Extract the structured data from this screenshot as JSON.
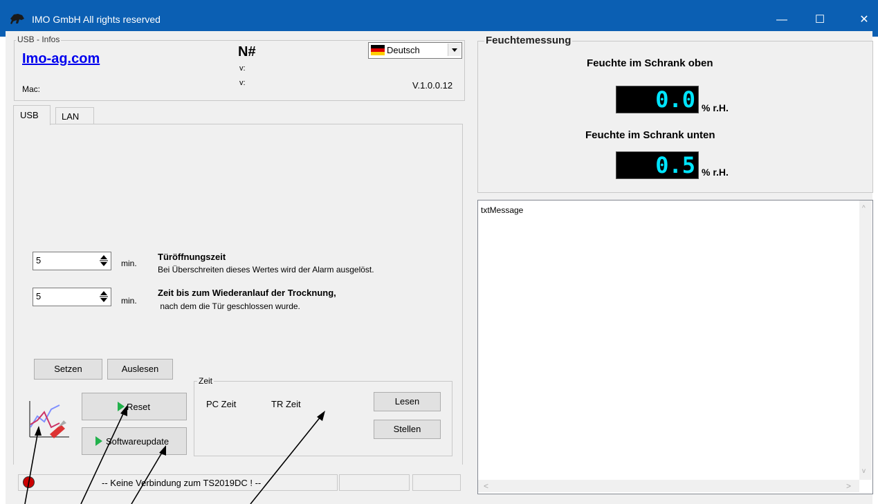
{
  "window": {
    "title": "IMO GmbH   All rights reserved",
    "minimize_glyph": "—",
    "maximize_glyph": "☐",
    "close_glyph": "✕"
  },
  "usb_info": {
    "legend": "USB - Infos",
    "link": "Imo-ag.com",
    "n_label": "N#",
    "v1_label": "v:",
    "v2_label": "v:",
    "mac_label": "Mac:",
    "version": "V.1.0.0.12",
    "language": "Deutsch"
  },
  "tabs": [
    {
      "label": "USB",
      "active": true
    },
    {
      "label": "LAN",
      "active": false
    }
  ],
  "settings": {
    "door_time": {
      "value": "5",
      "unit": "min.",
      "title": "Türöffnungszeit",
      "desc": "Bei Überschreiten dieses Wertes wird der Alarm ausgelöst."
    },
    "restart_time": {
      "value": "5",
      "unit": "min.",
      "title": "Zeit bis zum Wiederanlauf der Trocknung,",
      "desc": " nach dem die Tür geschlossen wurde."
    }
  },
  "buttons": {
    "set": "Setzen",
    "read": "Auslesen",
    "reset": "Reset",
    "update": "Softwareupdate"
  },
  "zeit": {
    "legend": "Zeit",
    "pc_label": "PC Zeit",
    "tr_label": "TR Zeit",
    "read": "Lesen",
    "set": "Stellen"
  },
  "status": {
    "text": "-- Keine Verbindung zum TS2019DC ! --"
  },
  "humidity": {
    "legend": "Feuchtemessung",
    "top_label": "Feuchte im Schrank oben",
    "top_value": "0.0",
    "bottom_label": "Feuchte im Schrank unten",
    "bottom_value": "0.5",
    "unit": "% r.H."
  },
  "message": {
    "text": "txtMessage"
  },
  "colors": {
    "titlebar": "#0b5fb3",
    "lcd_digits": "#00e5ff",
    "link": "#0000ee"
  }
}
